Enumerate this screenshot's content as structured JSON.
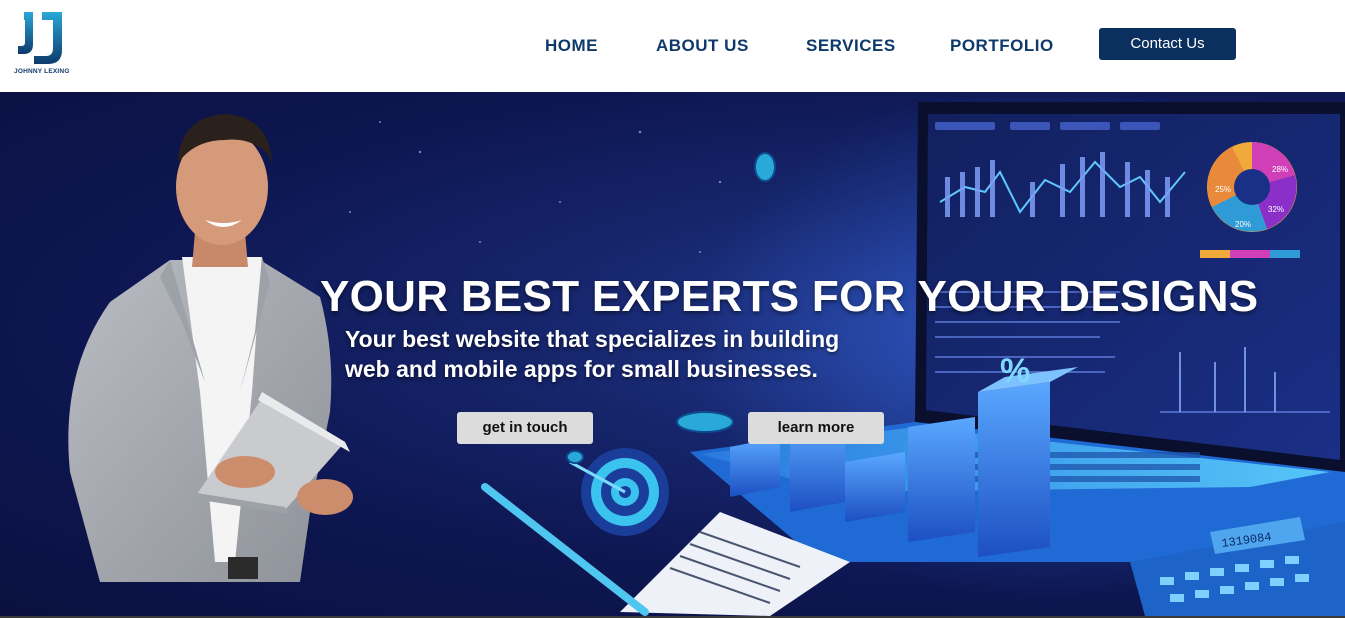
{
  "brand": {
    "logo_letters": "JJ",
    "name": "JOHNNY LEXING",
    "accent": "#1e7fc0",
    "navy": "#0d3a6b"
  },
  "nav": {
    "items": [
      {
        "label": "HOME"
      },
      {
        "label": "ABOUT US"
      },
      {
        "label": "SERVICES"
      },
      {
        "label": "PORTFOLIO"
      }
    ],
    "contact_label": "Contact Us"
  },
  "hero": {
    "title": "YOUR BEST EXPERTS FOR YOUR DESIGNS",
    "subtitle_line1": "Your best website that specializes in building",
    "subtitle_line2": "web and mobile apps for small businesses.",
    "primary_button": "get in touch",
    "secondary_button": "learn more",
    "illustration": "person-with-laptop-and-analytics-dashboard",
    "dashboard_percent_sign": "%",
    "calculator_display": "1319084",
    "pie_labels": [
      "25%",
      "28%",
      "32%",
      "20%"
    ]
  }
}
